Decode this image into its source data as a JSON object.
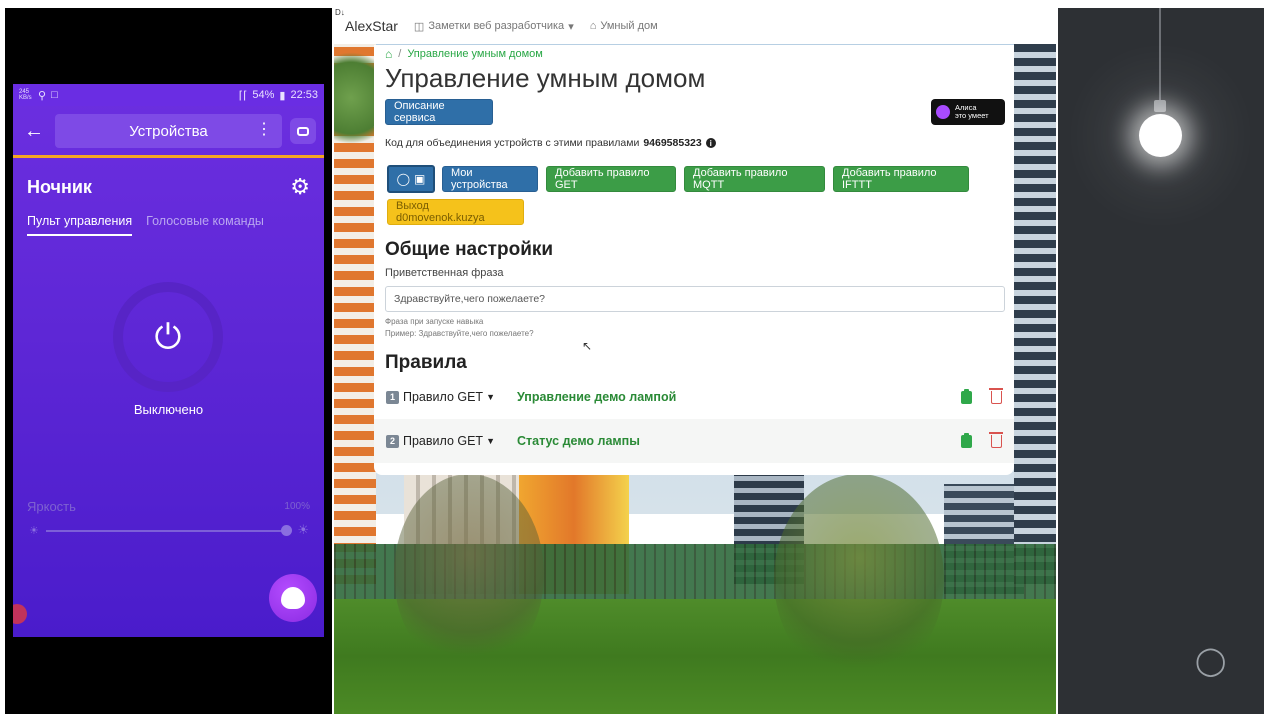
{
  "phone": {
    "status": {
      "net_speed": "245 KB/s",
      "battery": "54%",
      "time": "22:53"
    },
    "appbar_title": "Устройства",
    "device_name": "Ночник",
    "tabs": [
      "Пульт управления",
      "Голосовые команды"
    ],
    "power_state": "Выключено",
    "brightness_label": "Яркость",
    "brightness_value": "100%",
    "icons": {
      "back": "arrow-left-icon",
      "menu": "more-vertical-icon",
      "tv": "tv-icon",
      "settings": "gear-icon",
      "power": "power-icon",
      "alice": "alice-icon"
    },
    "colors": {
      "background": "#5e27d6",
      "accent": "#f5a623"
    }
  },
  "browser": {
    "brand": "AlexStar",
    "brand_sup": "D↓",
    "nav": [
      "Заметки веб разработчика",
      "Умный дом"
    ],
    "breadcrumb": "Управление умным домом",
    "title": "Управление умным домом",
    "description_button": "Описание сервиса",
    "alice_badge": [
      "Алиса",
      "это умеет"
    ],
    "code_label": "Код для объединения устройств с этими правилами",
    "code_value": "9469585323",
    "buttons": {
      "my_devices": "Мои устройства",
      "add_get": "Добавить правило GET",
      "add_mqtt": "Добавить правило MQTT",
      "add_ifttt": "Добавить правило IFTTT",
      "logout": "Выход d0movenok.kuzya"
    },
    "general_settings": {
      "title": "Общие настройки",
      "greeting_label": "Приветственная фраза",
      "greeting_value": "Здравствуйте,чего пожелаете?",
      "hint_line1": "Фраза при запуске навыка",
      "hint_line2": "Пример: Здравствуйте,чего пожелаете?"
    },
    "rules": {
      "title": "Правила",
      "items": [
        {
          "num": "1",
          "type": "Правило GET",
          "name": "Управление демо лампой"
        },
        {
          "num": "2",
          "type": "Правило GET",
          "name": "Статус демо лампы"
        }
      ]
    },
    "colors": {
      "primary": "#2f6fa8",
      "success": "#3c9d47",
      "warning": "#f5c21b",
      "danger": "#d9534f"
    }
  },
  "lamp_panel": {
    "bulb_state": "on",
    "icons": {
      "bulb": "lightbulb-icon"
    }
  }
}
